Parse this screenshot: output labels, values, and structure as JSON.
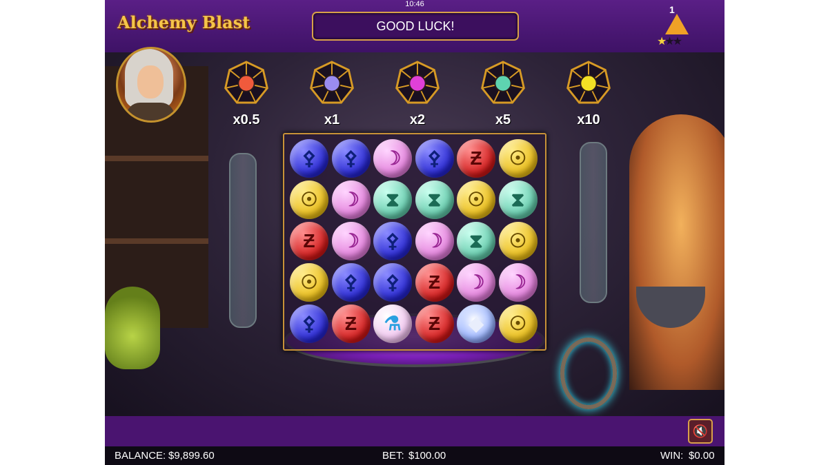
{
  "clock": "10:46",
  "game": {
    "title": "Alchemy Blast"
  },
  "message": "GOOD LUCK!",
  "level": {
    "number": "1",
    "stars_filled": 1,
    "stars_total": 3
  },
  "multipliers": [
    {
      "label": "x0.5",
      "color": "#f05a3c"
    },
    {
      "label": "x1",
      "color": "#9a8cf0"
    },
    {
      "label": "x2",
      "color": "#e040d8"
    },
    {
      "label": "x5",
      "color": "#5ed3b0"
    },
    {
      "label": "x10",
      "color": "#f2e025"
    }
  ],
  "board": {
    "rows": [
      [
        "blue",
        "blue",
        "pink",
        "blue",
        "red",
        "yellow"
      ],
      [
        "yellow",
        "pink",
        "green",
        "green",
        "yellow",
        "green"
      ],
      [
        "red",
        "pink",
        "blue",
        "pink",
        "green",
        "yellow"
      ],
      [
        "yellow",
        "blue",
        "blue",
        "red",
        "pink",
        "pink"
      ],
      [
        "blue",
        "red",
        "potion",
        "red",
        "crystal",
        "yellow"
      ]
    ]
  },
  "footer": {
    "balance_label": "BALANCE:",
    "balance_value": "$9,899.60",
    "bet_label": "BET:",
    "bet_value": "$100.00",
    "win_label": "WIN:",
    "win_value": "$0.00"
  },
  "icons": {
    "mute": "speaker-mute-icon"
  }
}
